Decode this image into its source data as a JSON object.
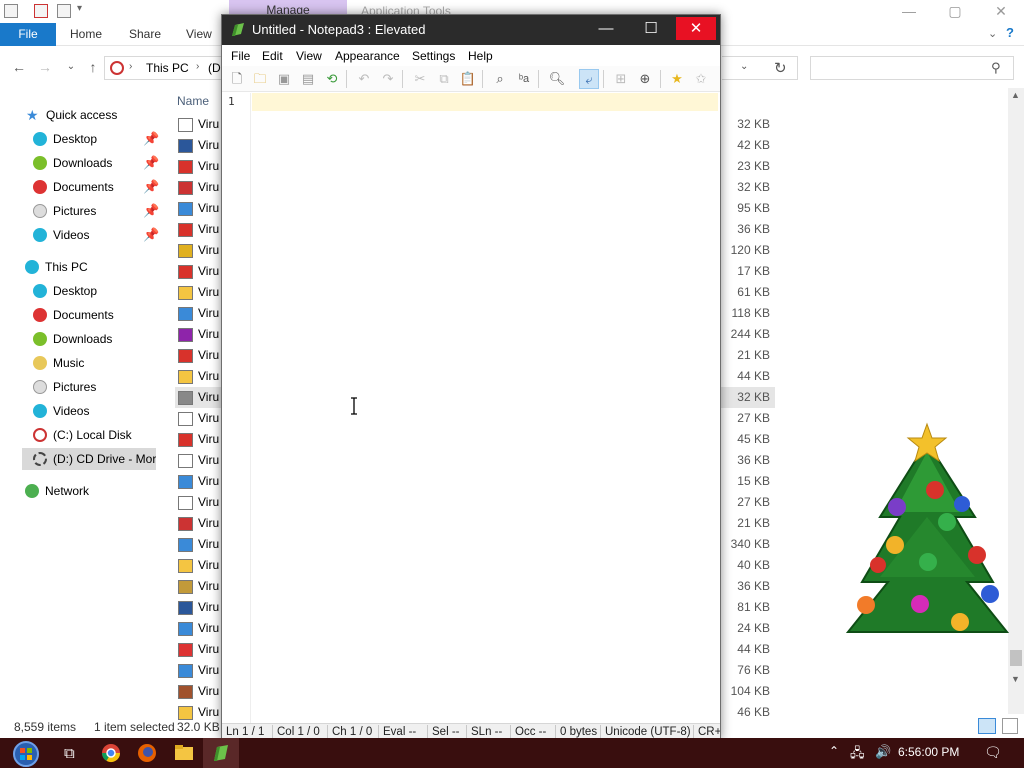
{
  "explorer": {
    "title_faded": "Application Tools",
    "contextual_tab": "Manage",
    "ribbon": {
      "file": "File",
      "tabs": [
        "Home",
        "Share",
        "View"
      ]
    },
    "address": {
      "segment1": "This PC",
      "segment2": "(D"
    },
    "nav": {
      "quick_access": "Quick access",
      "qa_items": [
        "Desktop",
        "Downloads",
        "Documents",
        "Pictures",
        "Videos"
      ],
      "this_pc": "This PC",
      "pc_items": [
        "Desktop",
        "Documents",
        "Downloads",
        "Music",
        "Pictures",
        "Videos",
        "(C:) Local Disk",
        "(D:) CD Drive - More"
      ],
      "network": "Network"
    },
    "column_name": "Name",
    "file_name_prefix": "Viru",
    "sizes": [
      "32 KB",
      "42 KB",
      "23 KB",
      "32 KB",
      "95 KB",
      "36 KB",
      "120 KB",
      "17 KB",
      "61 KB",
      "118 KB",
      "244 KB",
      "21 KB",
      "44 KB",
      "32 KB",
      "27 KB",
      "45 KB",
      "36 KB",
      "15 KB",
      "27 KB",
      "21 KB",
      "340 KB",
      "40 KB",
      "36 KB",
      "81 KB",
      "24 KB",
      "44 KB",
      "76 KB",
      "104 KB",
      "46 KB"
    ],
    "selected_row_index": 13,
    "status": {
      "count": "8,559 items",
      "selected": "1 item selected",
      "size": "32.0 KB"
    }
  },
  "notepad": {
    "title": "Untitled - Notepad3 : Elevated",
    "menu": [
      "File",
      "Edit",
      "View",
      "Appearance",
      "Settings",
      "Help"
    ],
    "line_number": "1",
    "content": "",
    "status": {
      "ln": "Ln  1 / 1",
      "col": "Col  1 / 0",
      "ch": "Ch  1 / 0",
      "eval": "Eval  --",
      "sel": "Sel  --",
      "sln": "SLn  --",
      "occ": "Occ  --",
      "bytes": "0 bytes",
      "encoding": "Unicode (UTF-8)",
      "eol": "CR+"
    },
    "toolbar_icons": [
      "new-icon",
      "open-icon",
      "save-icon",
      "save-as-icon",
      "revert-icon",
      "undo-icon",
      "redo-icon",
      "cut-icon",
      "copy-icon",
      "paste-icon",
      "find-icon",
      "replace-icon",
      "find-in-files-icon",
      "word-wrap-icon",
      "zoom-icon",
      "favorites-icon",
      "add-favorite-icon"
    ]
  },
  "taskbar": {
    "time": "6:56:00 PM",
    "apps": [
      "start-icon",
      "task-view-icon",
      "chrome-icon",
      "firefox-icon",
      "file-explorer-icon",
      "notepad3-icon"
    ]
  },
  "colors": {
    "ribbon_file_bg": "#1979ca",
    "manage_tab_bg": "#d8c4f0",
    "notepad_titlebar": "#2b2b2b",
    "close_red": "#e81123",
    "current_line": "#fff7d6",
    "taskbar_bg": "#390e0e"
  }
}
